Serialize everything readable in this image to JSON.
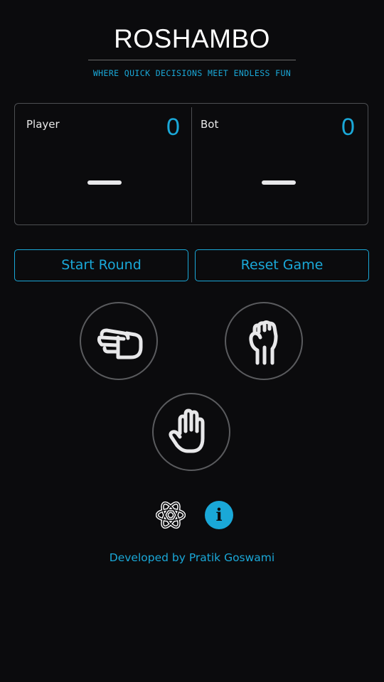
{
  "header": {
    "title": "ROSHAMBO",
    "tagline": "WHERE QUICK DECISIONS MEET ENDLESS FUN"
  },
  "scoreboard": {
    "player": {
      "label": "Player",
      "score": "0"
    },
    "bot": {
      "label": "Bot",
      "score": "0"
    }
  },
  "controls": {
    "start_label": "Start Round",
    "reset_label": "Reset Game"
  },
  "moves": [
    {
      "icon": "scissors-hand-icon"
    },
    {
      "icon": "rock-fist-icon"
    },
    {
      "icon": "paper-hand-icon"
    }
  ],
  "footer": {
    "icons": [
      "react-atom-icon",
      "info-icon"
    ],
    "info_glyph": "i",
    "credit": "Developed by Pratik Goswami"
  },
  "colors": {
    "background": "#0b0b0d",
    "accent": "#1aa8d8",
    "text": "#ffffff",
    "border": "#4d4f52"
  }
}
